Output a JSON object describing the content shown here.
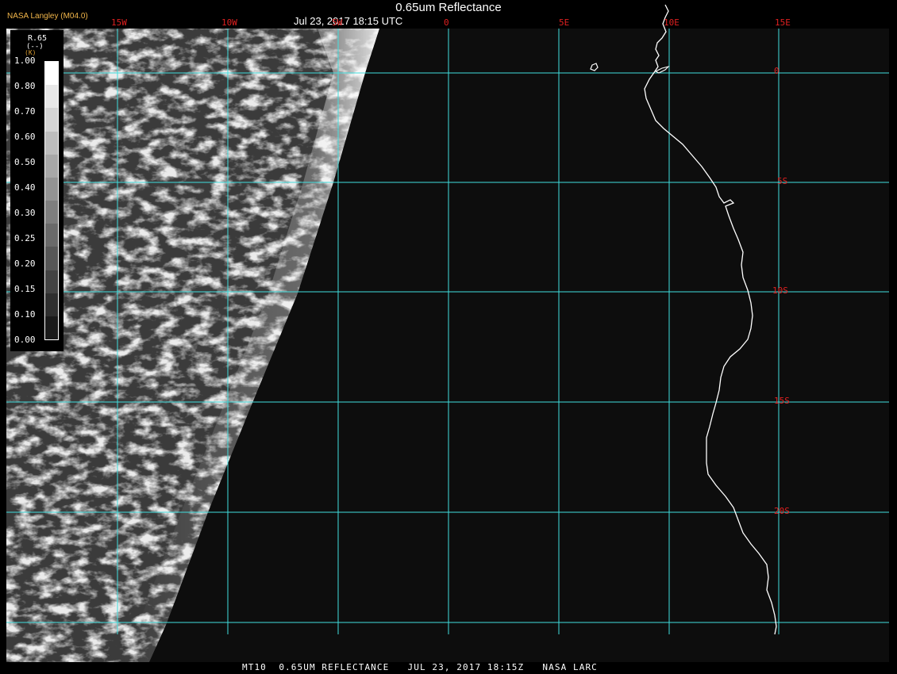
{
  "map": {
    "title": "0.65um Reflectance",
    "date_time": "Jul 23, 2017 18:15 UTC",
    "producer": "NASA Langley (M04.0)",
    "caption": "MT10  0.65UM REFLECTANCE   JUL 23, 2017 18:15Z   NASA LARC",
    "grid_color": "#41dede",
    "label_color": "#e02020",
    "coast_color": "#ffffff",
    "longitude_labels": [
      "15W",
      "10W",
      "5W",
      "0",
      "5E",
      "10E",
      "15E"
    ],
    "latitude_labels": [
      "0",
      "5S",
      "10S",
      "15S",
      "20S"
    ]
  },
  "legend": {
    "title": "R.65",
    "unit": "(--)",
    "unit_extra": "(K)",
    "ticks": [
      "1.00",
      "0.80",
      "0.70",
      "0.60",
      "0.50",
      "0.40",
      "0.30",
      "0.25",
      "0.20",
      "0.15",
      "0.10",
      "0.00"
    ],
    "swatch_colors": [
      "#ffffff",
      "#e8e8e8",
      "#d4d4d4",
      "#bdbdbd",
      "#a8a8a8",
      "#939393",
      "#7e7e7e",
      "#6a6a6a",
      "#575757",
      "#434343",
      "#2f2f2f",
      "#1a1a1a"
    ]
  }
}
